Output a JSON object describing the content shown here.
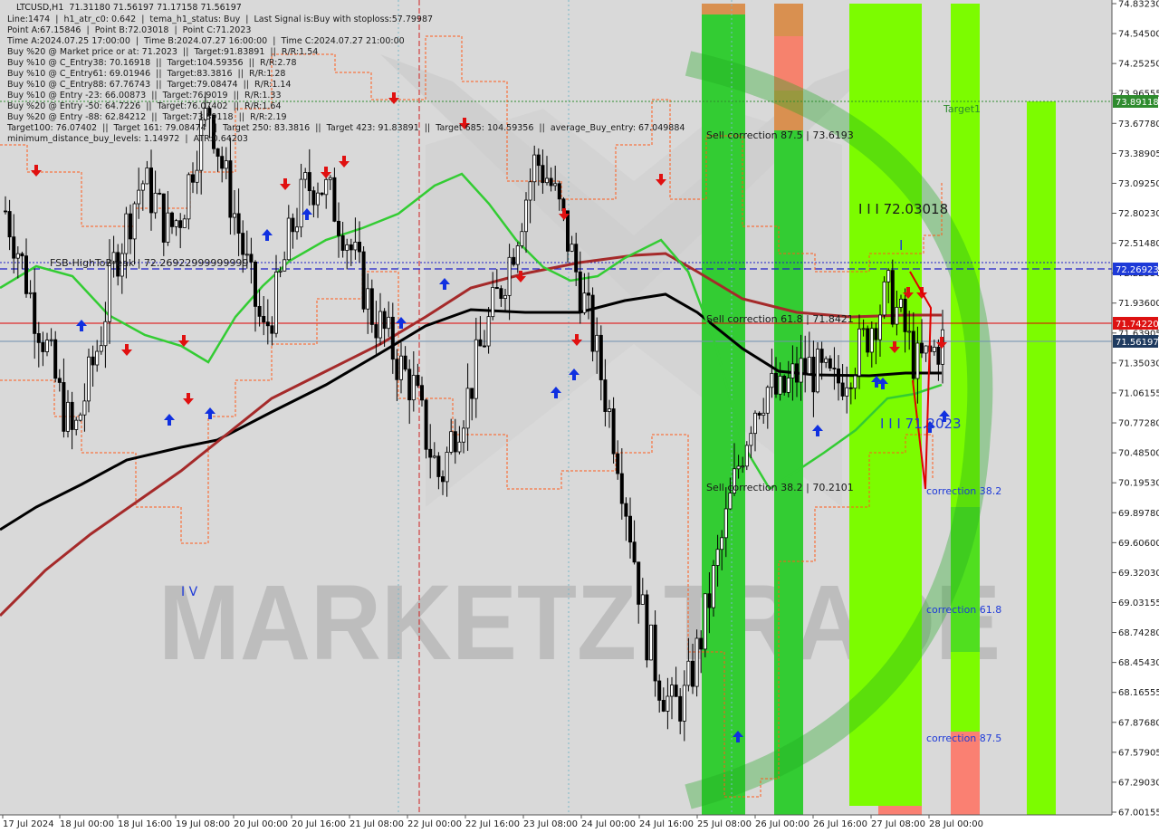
{
  "header": {
    "lines": [
      "LTCUSD,H1  71.31180 71.56197 71.17158 71.56197",
      "Line:1474  |  h1_atr_c0: 0.642  |  tema_h1_status: Buy  |  Last Signal is:Buy with stoploss:57.79987",
      "Point A:67.15846  |  Point B:72.03018  |  Point C:71.2023",
      "Time A:2024.07.25 17:00:00  |  Time B:2024.07.27 16:00:00  |  Time C:2024.07.27 21:00:00",
      "Buy %20 @ Market price or at: 71.2023  ||  Target:91.83891  ||  R/R:1.54",
      "Buy %10 @ C_Entry38: 70.16918  ||  Target:104.59356  ||  R/R:2.78",
      "Buy %10 @ C_Entry61: 69.01946  ||  Target:83.3816  ||  R/R:1.28",
      "Buy %10 @ C_Entry88: 67.76743  ||  Target:79.08474  ||  R/R:1.14",
      "Buy %10 @ Entry -23: 66.00873  ||  Target:76.9019  ||  R/R:1.33",
      "Buy %20 @ Entry -50: 64.7226  ||  Target:76.07402  ||  R/R:1.64",
      "Buy %20 @ Entry -88: 62.84212  ||  Target:73.89118  ||  R/R:2.19",
      "Target100: 76.07402  ||  Target 161: 79.08474  ||  Target 250: 83.3816  ||  Target 423: 91.83891  ||  Target 685: 104.59356  ||  average_Buy_entry: 67.049884",
      "minimum_distance_buy_levels: 1.14972  |  ATR:0.64203"
    ]
  },
  "annotations": {
    "fsb": "FSB-HighToBreak | 72.26922999999999",
    "sell875": "Sell correction 87.5 | 73.6193",
    "sell618": "Sell correction 61.8 | 71.8421",
    "sell382": "Sell correction 38.2 | 70.2101",
    "wave_b": "I I I 72.03018",
    "wave_c": "I I I 71.2023",
    "wave_i": "I",
    "wave_iv": "I V",
    "target1": "Target1",
    "corr382": "correction 38.2",
    "corr618": "correction 61.8",
    "corr875": "correction 87.5",
    "watermark": "MARKETZ TRADE"
  },
  "price_labels": {
    "target1": "73.89118",
    "fsb": "72.26923",
    "red": "71.74220",
    "current": "71.56197"
  },
  "colors": {
    "background": "#d9d9d9",
    "bull_candle": "#000000",
    "green_ma": "#33cc33",
    "brown_ma": "#a52a2a",
    "black_ma": "#000000",
    "zone_green": "#33cc33",
    "zone_lime": "#7cfc00",
    "zone_salmon": "#fa8072",
    "zone_orange": "#d99050",
    "fsb_line": "#1e1ec8",
    "red_line": "#e00000",
    "target_line": "#2e8b2e",
    "current_label": "#1e3a5f",
    "red_label": "#dd1111",
    "fsb_label": "#1e3ad8",
    "target_label": "#2e8b2e"
  },
  "chart_data": {
    "type": "candlestick",
    "title": "LTCUSD,H1",
    "ylim": [
      67.0,
      74.8
    ],
    "y_ticks": [
      "74.83230",
      "74.54500",
      "74.25250",
      "73.96555",
      "73.67780",
      "73.38905",
      "73.09250",
      "72.80230",
      "72.51480",
      "72.22550",
      "71.93600",
      "71.63905",
      "71.35030",
      "71.06155",
      "70.77280",
      "70.48500",
      "70.19530",
      "69.89780",
      "69.60600",
      "69.32030",
      "69.03155",
      "68.74280",
      "68.45430",
      "68.16555",
      "67.87680",
      "67.57905",
      "67.29030",
      "67.00155"
    ],
    "x_ticks": [
      "17 Jul 2024",
      "18 Jul 00:00",
      "18 Jul 16:00",
      "19 Jul 08:00",
      "20 Jul 00:00",
      "20 Jul 16:00",
      "21 Jul 08:00",
      "22 Jul 00:00",
      "22 Jul 16:00",
      "23 Jul 08:00",
      "24 Jul 00:00",
      "24 Jul 16:00",
      "25 Jul 08:00",
      "26 Jul 00:00",
      "26 Jul 16:00",
      "27 Jul 08:00",
      "28 Jul 00:00"
    ],
    "close_path": [
      72.8,
      72.4,
      71.9,
      71.5,
      71.0,
      70.6,
      71.1,
      71.6,
      72.3,
      72.7,
      73.1,
      72.9,
      72.6,
      72.8,
      73.4,
      73.8,
      73.2,
      72.7,
      72.1,
      71.6,
      72.0,
      72.6,
      73.0,
      73.1,
      72.9,
      72.6,
      72.2,
      71.8,
      71.6,
      71.3,
      71.1,
      70.6,
      70.2,
      70.7,
      71.0,
      71.5,
      71.9,
      72.3,
      72.8,
      73.3,
      73.1,
      72.7,
      72.2,
      71.7,
      71.1,
      70.5,
      69.7,
      68.8,
      68.3,
      68.0,
      68.1,
      68.6,
      69.2,
      69.8,
      70.4,
      70.9,
      71.1,
      71.0,
      71.2,
      71.3,
      71.2,
      71.1,
      71.3,
      71.5,
      71.8,
      72.0,
      71.7,
      71.3,
      71.4,
      71.56
    ],
    "open": 71.3118,
    "high": 71.56197,
    "low": 71.17158,
    "close": 71.56197,
    "levels": {
      "target1": 73.89118,
      "fsb_high_to_break": 72.26923,
      "red_level": 71.7422,
      "current": 71.56197,
      "point_a": 67.15846,
      "point_b": 72.03018,
      "point_c": 71.2023
    },
    "grid": false
  }
}
